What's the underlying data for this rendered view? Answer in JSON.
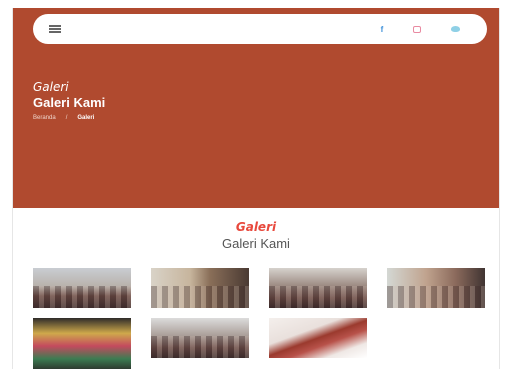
{
  "navbar": {
    "menu_icon": "hamburger-menu-icon",
    "social_icons": [
      "facebook-icon",
      "instagram-icon",
      "twitter-icon"
    ],
    "facebook_glyph": "f"
  },
  "hero": {
    "subtitle": "Galeri",
    "title": "Galeri Kami",
    "breadcrumb": {
      "home": "Beranda",
      "separator": "/",
      "current": "Galeri"
    },
    "background_color": "#b04a2f"
  },
  "section": {
    "subtitle": "Galeri",
    "title": "Galeri Kami",
    "accent_color": "#e8493d"
  },
  "gallery": {
    "count": 7
  }
}
